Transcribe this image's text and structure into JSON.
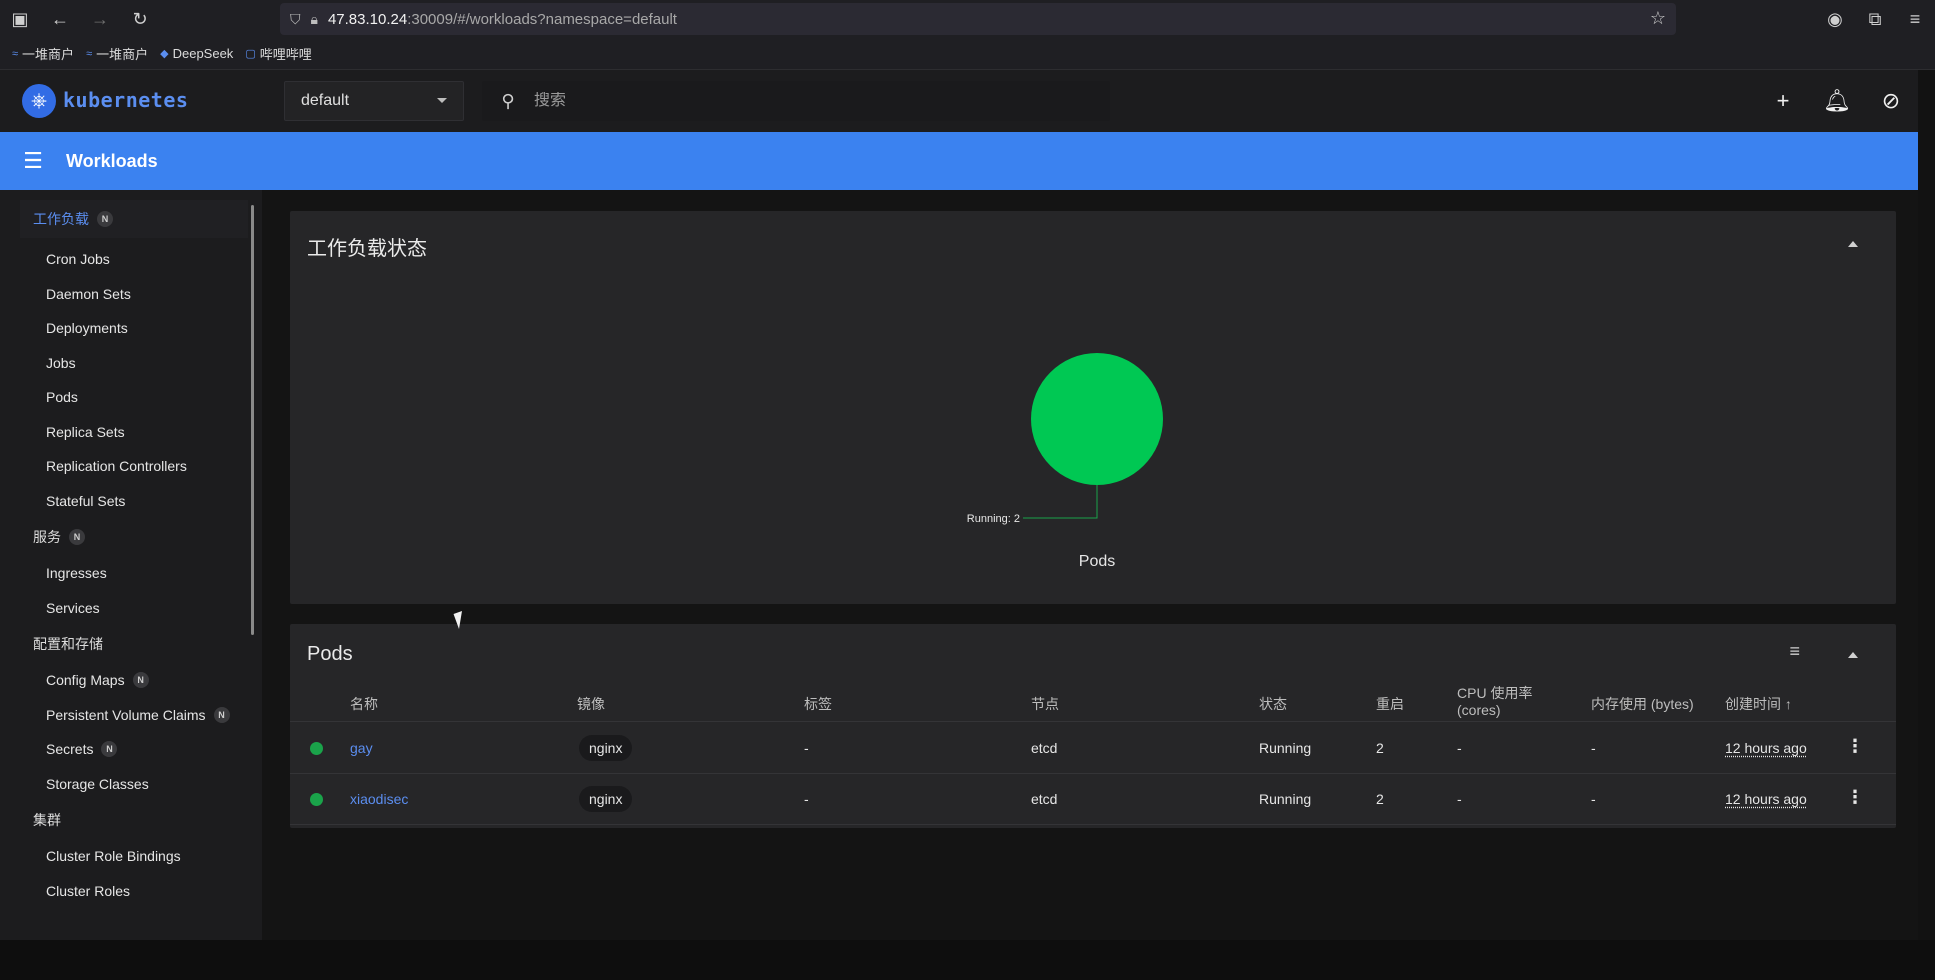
{
  "browser": {
    "url_host": "47.83.10.24",
    "url_rest": ":30009/#/workloads?namespace=default",
    "bookmarks": [
      {
        "label": "一堆商户",
        "icon": "bookmark-icon"
      },
      {
        "label": "一堆商户",
        "icon": "bookmark-icon"
      },
      {
        "label": "DeepSeek",
        "icon": "deepseek-icon"
      },
      {
        "label": "哔哩哔哩",
        "icon": "bilibili-icon"
      }
    ]
  },
  "header": {
    "logo_text": "kubernetes",
    "namespace": "default",
    "search_placeholder": "搜索"
  },
  "toolbar": {
    "title": "Workloads"
  },
  "sidebar": {
    "sections": [
      {
        "label": "工作负载",
        "badge": "N",
        "items": [
          "Cron Jobs",
          "Daemon Sets",
          "Deployments",
          "Jobs",
          "Pods",
          "Replica Sets",
          "Replication Controllers",
          "Stateful Sets"
        ]
      },
      {
        "label": "服务",
        "badge": "N",
        "items": [
          "Ingresses",
          "Services"
        ]
      },
      {
        "label": "配置和存储",
        "items": [
          "Config Maps",
          "Persistent Volume Claims",
          "Secrets",
          "Storage Classes"
        ]
      },
      {
        "label": "集群",
        "items": [
          "Cluster Role Bindings",
          "Cluster Roles"
        ]
      }
    ],
    "item_badges": {
      "Config Maps": "N",
      "Persistent Volume Claims": "N",
      "Secrets": "N"
    }
  },
  "status_card": {
    "title": "工作负载状态"
  },
  "chart_data": {
    "type": "pie",
    "title": "Pods",
    "slices": [
      {
        "label": "Running",
        "value": 2,
        "color": "#00c853"
      }
    ]
  },
  "pods_card": {
    "title": "Pods",
    "columns": [
      "名称",
      "镜像",
      "标签",
      "节点",
      "状态",
      "重启",
      "CPU 使用率 (cores)",
      "内存使用 (bytes)",
      "创建时间"
    ],
    "rows": [
      {
        "name": "gay",
        "image": "nginx",
        "labels": "-",
        "node": "etcd",
        "status": "Running",
        "restarts": "2",
        "cpu": "-",
        "memory": "-",
        "created": "12 hours ago"
      },
      {
        "name": "xiaodisec",
        "image": "nginx",
        "labels": "-",
        "node": "etcd",
        "status": "Running",
        "restarts": "2",
        "cpu": "-",
        "memory": "-",
        "created": "12 hours ago"
      }
    ]
  },
  "colors": {
    "accent": "#3b82f0",
    "running": "#00c853",
    "link": "#5b8ef0"
  }
}
